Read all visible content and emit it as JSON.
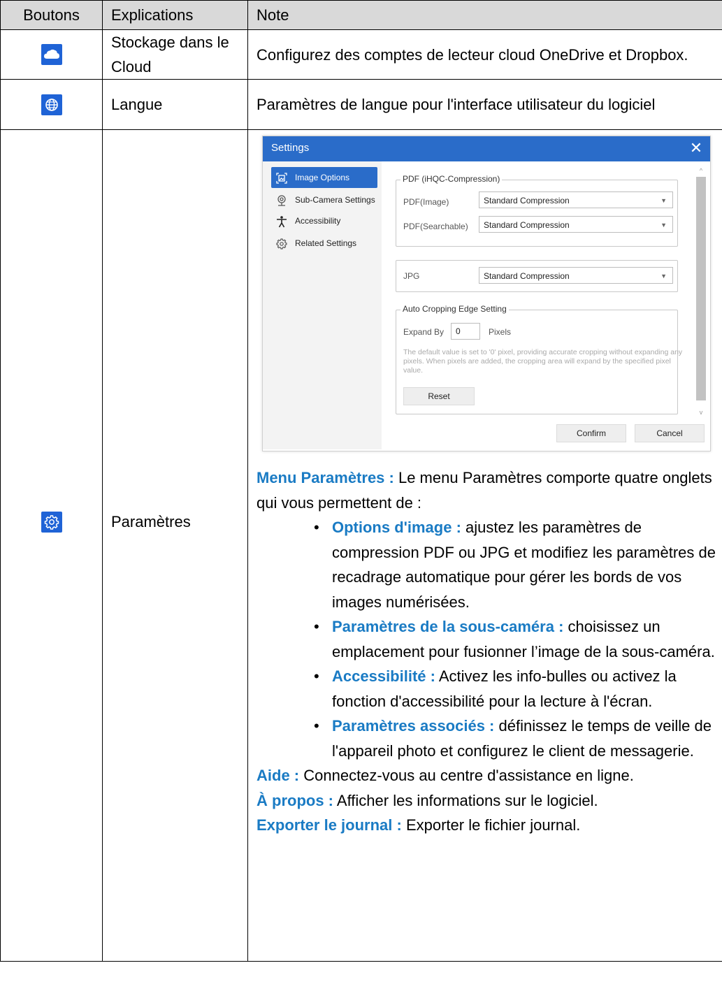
{
  "table": {
    "headers": [
      "Boutons",
      "Explications",
      "Note"
    ]
  },
  "rows": [
    {
      "icon": "cloud-icon",
      "explication": "Stockage dans le Cloud",
      "note": "Configurez des comptes de lecteur cloud OneDrive et Dropbox."
    },
    {
      "icon": "globe-icon",
      "explication": "Langue",
      "note": "Paramètres de langue pour l'interface utilisateur du logiciel"
    },
    {
      "icon": "gear-icon",
      "explication": "Paramètres"
    }
  ],
  "dialog": {
    "title": "Settings",
    "close": "✕",
    "nav": [
      {
        "label": "Image Options",
        "icon": "image-options-icon",
        "selected": true
      },
      {
        "label": "Sub-Camera Settings",
        "icon": "webcam-icon",
        "selected": false
      },
      {
        "label": "Accessibility",
        "icon": "accessibility-icon",
        "selected": false
      },
      {
        "label": "Related Settings",
        "icon": "gear-icon",
        "selected": false
      }
    ],
    "pdf_group": {
      "title": "PDF (iHQC-Compression)",
      "image_label": "PDF(Image)",
      "image_value": "Standard Compression",
      "searchable_label": "PDF(Searchable)",
      "searchable_value": "Standard Compression"
    },
    "jpg_group": {
      "label": "JPG",
      "value": "Standard Compression"
    },
    "crop_group": {
      "title": "Auto Cropping Edge Setting",
      "expand_label": "Expand By",
      "expand_value": "0",
      "unit": "Pixels",
      "hint": "The default value is set to '0' pixel, providing accurate cropping without expanding any pixels. When pixels are added, the cropping area will expand by the specified pixel value.",
      "reset": "Reset"
    },
    "confirm": "Confirm",
    "cancel": "Cancel"
  },
  "settings_text": {
    "menu_title": "Menu Paramètres :",
    "menu_desc": " Le menu Paramètres comporte quatre onglets qui vous permettent de :",
    "bullets": [
      {
        "title": "Options d'image :",
        "text": " ajustez les paramètres de compression PDF ou JPG et modifiez les paramètres de recadrage automatique pour gérer les bords de vos images numérisées."
      },
      {
        "title": "Paramètres de la sous-caméra :",
        "text": " choisissez un emplacement pour fusionner l’image de la sous-caméra."
      },
      {
        "title": "Accessibilité :",
        "text": " Activez les info-bulles ou activez la fonction d'accessibilité pour la lecture à l'écran."
      },
      {
        "title": "Paramètres associés :",
        "text": " définissez le temps de veille de l'appareil photo et configurez le client de messagerie."
      }
    ],
    "help_title": "Aide :",
    "help_text": " Connectez-vous au centre d'assistance en ligne.",
    "about_title": "À propos :",
    "about_text": " Afficher les informations sur le logiciel.",
    "export_title": "Exporter le journal :",
    "export_text": " Exporter le fichier journal."
  },
  "colors": {
    "header_bg": "#d9d9d9",
    "icon_blue": "#1f63d6",
    "dialog_blue": "#2a6cc9",
    "accent_text": "#1a7bc4"
  }
}
